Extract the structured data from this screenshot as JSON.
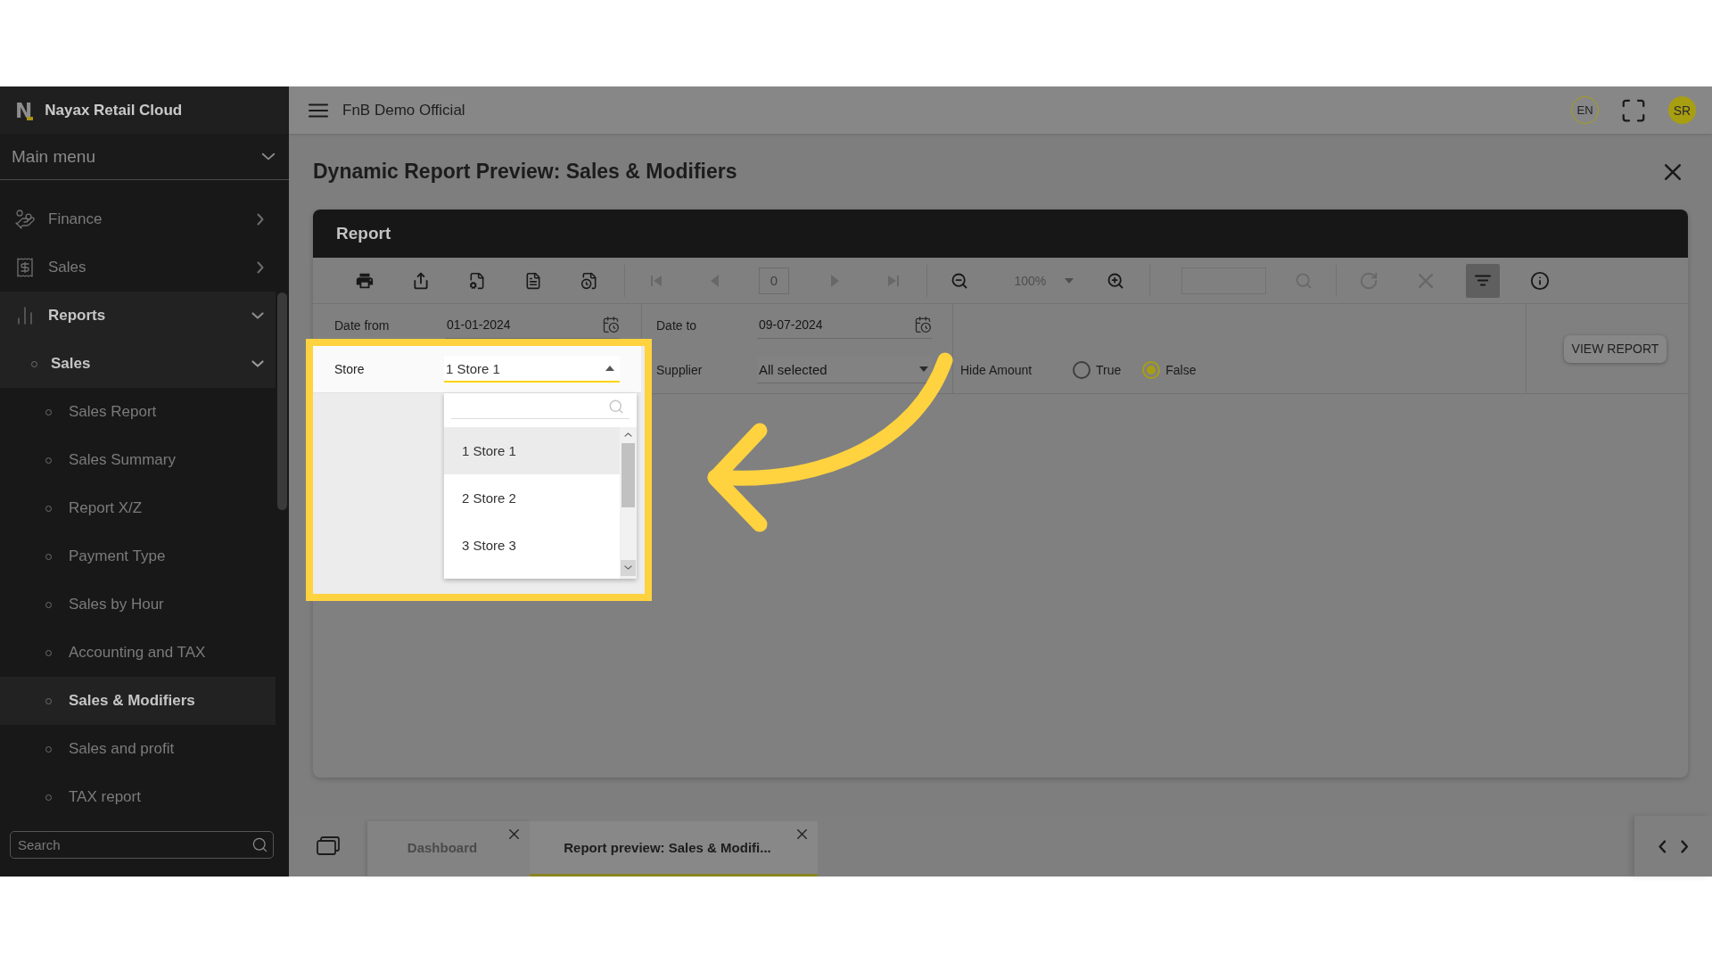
{
  "sidebar": {
    "logo": "N",
    "brand": "Nayax Retail Cloud",
    "menu_title": "Main menu",
    "items": [
      {
        "label": "Finance",
        "expanded": false
      },
      {
        "label": "Sales",
        "expanded": false
      },
      {
        "label": "Reports",
        "expanded": true,
        "children": [
          {
            "label": "Sales",
            "expanded": true,
            "children": [
              {
                "label": "Sales Report",
                "selected": false
              },
              {
                "label": "Sales Summary",
                "selected": false
              },
              {
                "label": "Report X/Z",
                "selected": false
              },
              {
                "label": "Payment Type",
                "selected": false
              },
              {
                "label": "Sales by Hour",
                "selected": false
              },
              {
                "label": "Accounting and TAX",
                "selected": false
              },
              {
                "label": "Sales & Modifiers",
                "selected": true
              },
              {
                "label": "Sales and profit",
                "selected": false
              },
              {
                "label": "TAX report",
                "selected": false
              }
            ]
          }
        ]
      }
    ],
    "search": {
      "placeholder": "Search"
    }
  },
  "topbar": {
    "company": "FnB Demo Official",
    "language": "EN",
    "avatar": "SR"
  },
  "page": {
    "title": "Dynamic Report Preview: Sales & Modifiers"
  },
  "report": {
    "title": "Report",
    "toolbar": {
      "page_number": "0",
      "zoom": "100%",
      "navigation_disabled": true,
      "zoom_disabled": true,
      "search_disabled": true,
      "filter_selected": true
    },
    "params": {
      "date_from": {
        "label": "Date from",
        "value": "01-01-2024"
      },
      "date_to": {
        "label": "Date to",
        "value": "09-07-2024"
      },
      "store": {
        "label": "Store",
        "value": "1 Store 1",
        "open": true,
        "options": [
          {
            "label": "1 Store 1",
            "selected": true
          },
          {
            "label": "2 Store 2",
            "selected": false
          },
          {
            "label": "3 Store 3",
            "selected": false
          }
        ]
      },
      "supplier": {
        "label": "Supplier",
        "value": "All selected"
      },
      "hide_amount": {
        "label": "Hide Amount",
        "options": [
          {
            "label": "True",
            "selected": false
          },
          {
            "label": "False",
            "selected": true
          }
        ]
      }
    },
    "view_button": "VIEW REPORT"
  },
  "tabs": [
    {
      "label": "Dashboard",
      "selected": false
    },
    {
      "label": "Report preview: Sales & Modifi...",
      "selected": true
    }
  ]
}
